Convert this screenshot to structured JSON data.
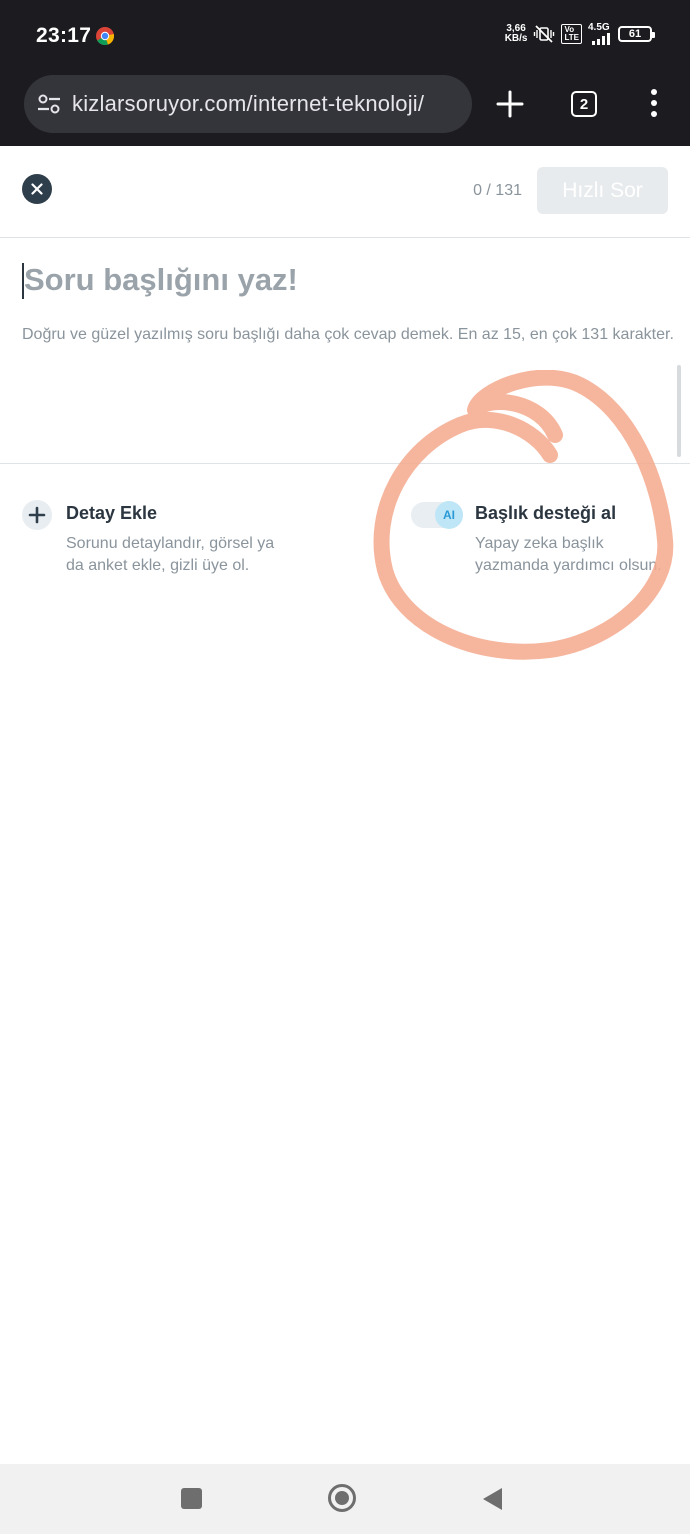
{
  "status_bar": {
    "time": "23:17",
    "net_speed_value": "3,66",
    "net_speed_unit": "KB/s",
    "lte_label_top": "Vo",
    "lte_label_bottom": "LTE",
    "network_type": "4.5G",
    "battery": "61"
  },
  "browser": {
    "url": "kizlarsoruyor.com/internet-teknoloji/",
    "tab_count": "2"
  },
  "header": {
    "counter": "0 / 131",
    "ask_button_label": "Hızlı Sor"
  },
  "title_input": {
    "placeholder": "Soru başlığını yaz!",
    "hint": "Doğru ve güzel yazılmış soru başlığı daha çok cevap demek. En az 15, en çok 131 karakter."
  },
  "options": {
    "detail": {
      "title": "Detay Ekle",
      "description": "Sorunu detaylandır, görsel ya da anket ekle, gizli üye ol."
    },
    "ai": {
      "title": "Başlık desteği al",
      "description": "Yapay zeka başlık yazmanda yardımcı olsun.",
      "badge": "AI",
      "toggle_on": false
    }
  },
  "colors": {
    "annotation": "#f4a98d",
    "dark_bar": "#1c1c20"
  }
}
